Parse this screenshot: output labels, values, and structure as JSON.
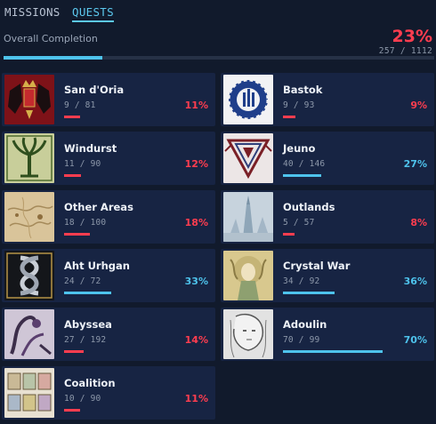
{
  "tabs": {
    "missions": "MISSIONS",
    "quests": "QUESTS"
  },
  "overall": {
    "label": "Overall Completion",
    "percent_label": "23%",
    "count": "257 / 1112",
    "progress": 0.23
  },
  "colors": {
    "accent_blue": "#4ec3ec",
    "accent_red": "#ff3d4f",
    "card_bg": "#172443",
    "page_bg": "#111a2c"
  },
  "cards": [
    {
      "name": "San d'Oria",
      "count": "9 / 81",
      "pct": "11%",
      "progress": 0.11,
      "tone": "red",
      "icon": "sandoria-crest-icon"
    },
    {
      "name": "Bastok",
      "count": "9 / 93",
      "pct": "9%",
      "progress": 0.09,
      "tone": "red",
      "icon": "bastok-emblem-icon"
    },
    {
      "name": "Windurst",
      "count": "11 / 90",
      "pct": "12%",
      "progress": 0.12,
      "tone": "red",
      "icon": "windurst-tree-icon"
    },
    {
      "name": "Jeuno",
      "count": "40 / 146",
      "pct": "27%",
      "progress": 0.27,
      "tone": "blue",
      "icon": "jeuno-triangle-icon"
    },
    {
      "name": "Other Areas",
      "count": "18 / 100",
      "pct": "18%",
      "progress": 0.18,
      "tone": "red",
      "icon": "map-parchment-icon"
    },
    {
      "name": "Outlands",
      "count": "5 / 57",
      "pct": "8%",
      "progress": 0.08,
      "tone": "red",
      "icon": "outlands-tower-icon"
    },
    {
      "name": "Aht Urhgan",
      "count": "24 / 72",
      "pct": "33%",
      "progress": 0.33,
      "tone": "blue",
      "icon": "aht-urhgan-serpent-icon"
    },
    {
      "name": "Crystal War",
      "count": "34 / 92",
      "pct": "36%",
      "progress": 0.36,
      "tone": "blue",
      "icon": "crystal-war-artwork-icon"
    },
    {
      "name": "Abyssea",
      "count": "27 / 192",
      "pct": "14%",
      "progress": 0.14,
      "tone": "red",
      "icon": "abyssea-artwork-icon"
    },
    {
      "name": "Adoulin",
      "count": "70 / 99",
      "pct": "70%",
      "progress": 0.7,
      "tone": "blue",
      "icon": "adoulin-sketch-icon"
    },
    {
      "name": "Coalition",
      "count": "10 / 90",
      "pct": "11%",
      "progress": 0.11,
      "tone": "red",
      "icon": "coalition-stamps-icon"
    }
  ]
}
